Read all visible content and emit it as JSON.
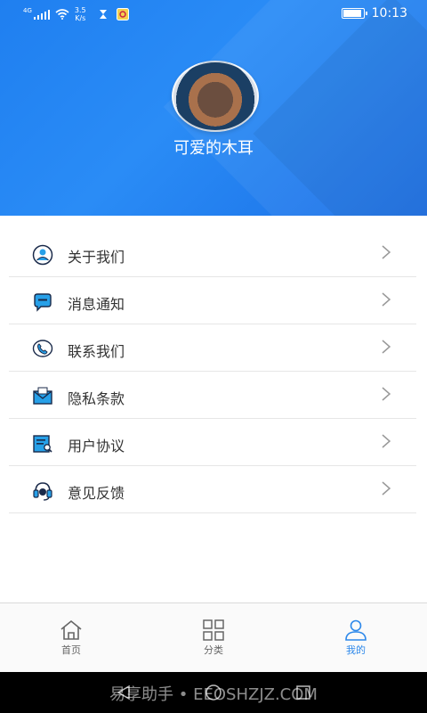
{
  "status_bar": {
    "network": "4G",
    "speed_value": "3.5",
    "speed_unit": "K/s",
    "time": "10:13"
  },
  "profile": {
    "nickname": "可爱的木耳"
  },
  "menu": {
    "items": [
      {
        "label": "关于我们",
        "icon": "person-circle-icon"
      },
      {
        "label": "消息通知",
        "icon": "chat-bubble-icon"
      },
      {
        "label": "联系我们",
        "icon": "phone-icon"
      },
      {
        "label": "隐私条款",
        "icon": "mail-icon"
      },
      {
        "label": "用户协议",
        "icon": "document-icon"
      },
      {
        "label": "意见反馈",
        "icon": "headset-icon"
      }
    ]
  },
  "tabbar": {
    "tabs": [
      {
        "label": "首页",
        "icon": "home-icon",
        "active": false
      },
      {
        "label": "分类",
        "icon": "grid-icon",
        "active": false
      },
      {
        "label": "我的",
        "icon": "user-icon",
        "active": true
      }
    ]
  },
  "colors": {
    "header_blue": "#1f7ff0",
    "active_tab": "#2d88ea",
    "icon_blue": "#27a0e8"
  },
  "system_nav": {
    "watermark": "易享助手 • EEOSHZJZ.COM"
  }
}
